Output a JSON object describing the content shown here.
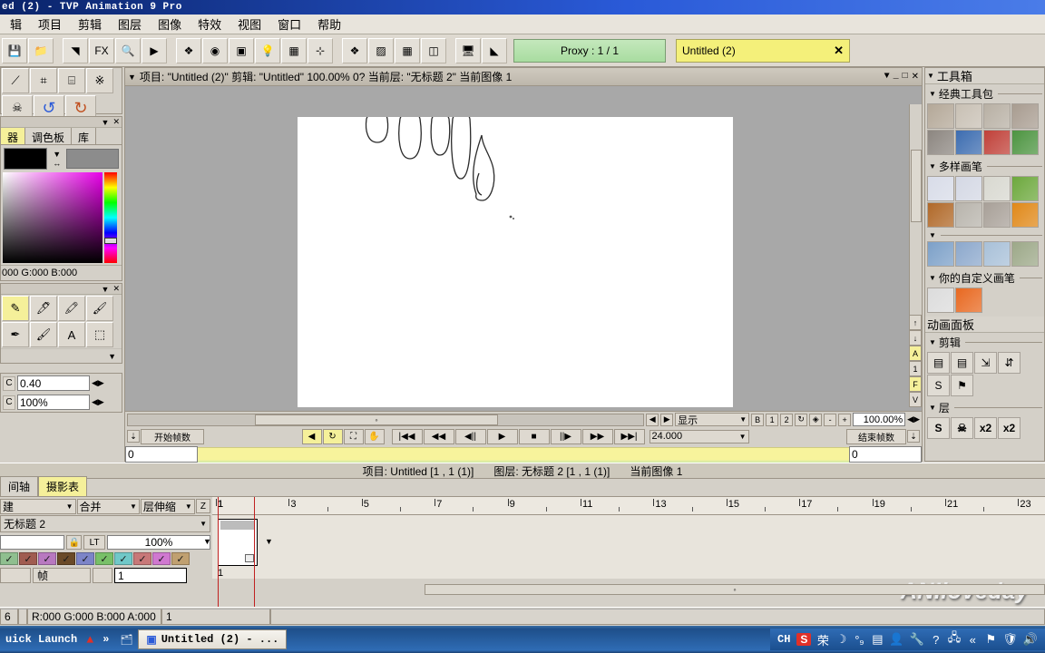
{
  "window": {
    "title": "ed (2) - TVP Animation 9 Pro"
  },
  "menubar": {
    "items": [
      {
        "label": "辑"
      },
      {
        "label": "项目"
      },
      {
        "label": "剪辑"
      },
      {
        "label": "图层"
      },
      {
        "label": "图像"
      },
      {
        "label": "特效"
      },
      {
        "label": "视图"
      },
      {
        "label": "窗口"
      },
      {
        "label": "帮助"
      }
    ]
  },
  "toolbar": {
    "buttons": [
      {
        "name": "save-button",
        "glyph": "💾"
      },
      {
        "name": "open-folder-button",
        "glyph": "📁"
      },
      {
        "name": "layers-stack-button",
        "glyph": "◥"
      },
      {
        "name": "fx-button",
        "glyph": "FX"
      },
      {
        "name": "zoom-button",
        "glyph": "🔍"
      },
      {
        "name": "play-button",
        "glyph": "▶"
      },
      {
        "name": "stack-button",
        "glyph": "❖"
      },
      {
        "name": "color-wheel-button",
        "glyph": "◉"
      },
      {
        "name": "gradient-button",
        "glyph": "▣"
      },
      {
        "name": "light-button",
        "glyph": "💡"
      },
      {
        "name": "grid-button",
        "glyph": "▦"
      },
      {
        "name": "axis-button",
        "glyph": "⊹"
      },
      {
        "name": "layers-red-button",
        "glyph": "❖"
      },
      {
        "name": "texture-button",
        "glyph": "▨"
      },
      {
        "name": "table-grid-button",
        "glyph": "▦"
      },
      {
        "name": "panel-split-button",
        "glyph": "◫"
      },
      {
        "name": "monitor-button",
        "glyph": "🖥"
      },
      {
        "name": "ramp-button",
        "glyph": "◣"
      }
    ],
    "proxy_label": "Proxy : 1 / 1",
    "document_tab": "Untitled (2)",
    "document_tab_close": "✕"
  },
  "left_panel": {
    "color_tabs": [
      {
        "label": "器",
        "active": true
      },
      {
        "label": "调色板",
        "active": false
      },
      {
        "label": "库",
        "active": false
      }
    ],
    "rgb_readout": "000 G:000 B:000",
    "tools": [
      {
        "name": "pencil-tool",
        "glyph": "✎",
        "selected": true
      },
      {
        "name": "pen-tool",
        "glyph": "🖊",
        "selected": false
      },
      {
        "name": "marker-tool",
        "glyph": "🖍",
        "selected": false
      },
      {
        "name": "brush-tool",
        "glyph": "🖌",
        "selected": false
      },
      {
        "name": "airbrush-tool",
        "glyph": "✒",
        "selected": false
      },
      {
        "name": "felt-tool",
        "glyph": "🖌",
        "selected": false
      },
      {
        "name": "text-tool",
        "glyph": "A",
        "selected": false
      },
      {
        "name": "select-tool",
        "glyph": "⬚",
        "selected": false
      }
    ],
    "fields": [
      {
        "prefix": "C",
        "value": "0.40"
      },
      {
        "prefix": "C",
        "value": "100%"
      }
    ],
    "top_tools": [
      {
        "name": "skull-button",
        "glyph": "☠"
      },
      {
        "name": "undo-button",
        "glyph": "↺"
      },
      {
        "name": "redo-button",
        "glyph": "↻"
      }
    ]
  },
  "document_window": {
    "info_line": "项目: \"Untitled (2)\"  剪辑: \"Untitled\"  100.00%   0?  当前层: \"无标题 2\"  当前图像 1",
    "minimize": "_",
    "maximize": "□",
    "close": "✕",
    "side_buttons": [
      {
        "label": "↑",
        "highlight": false
      },
      {
        "label": "↓",
        "highlight": false
      },
      {
        "label": "A",
        "highlight": true
      },
      {
        "label": "1",
        "highlight": false
      },
      {
        "label": "F",
        "highlight": true
      },
      {
        "label": "V",
        "highlight": false
      }
    ],
    "display_dropdown": "显示",
    "view_buttons": [
      "B",
      "1",
      "2"
    ],
    "refresh_button": "↻",
    "fit_button": "◈",
    "zoom_out": "-",
    "zoom_in": "+",
    "zoom_value": "100.00%",
    "playback": {
      "loop_buttons": [
        {
          "name": "direction-button",
          "glyph": "◀",
          "highlight": true
        },
        {
          "name": "loop-button",
          "glyph": "↻",
          "highlight": true
        },
        {
          "name": "range-button",
          "glyph": "⛶",
          "highlight": false
        },
        {
          "name": "hand-button",
          "glyph": "✋",
          "highlight": false
        }
      ],
      "transport_buttons": [
        {
          "name": "go-to-start-button",
          "glyph": "|◀◀"
        },
        {
          "name": "rewind-button",
          "glyph": "◀◀"
        },
        {
          "name": "step-back-button",
          "glyph": "◀||"
        },
        {
          "name": "play-button",
          "glyph": "▶"
        },
        {
          "name": "stop-button",
          "glyph": "■"
        },
        {
          "name": "step-forward-button",
          "glyph": "||▶"
        },
        {
          "name": "fast-forward-button",
          "glyph": "▶▶"
        },
        {
          "name": "go-to-end-button",
          "glyph": "▶▶|"
        }
      ],
      "fps_value": "24.000"
    },
    "start_frame_label": "开始帧数",
    "start_frame_value": "0",
    "end_frame_label": "结束帧数",
    "end_frame_value": "0"
  },
  "toolbox": {
    "title": "工具箱",
    "sections": [
      {
        "title": "经典工具包",
        "items": [
          {
            "name": "classic-pencil",
            "bg": "#b4a898"
          },
          {
            "name": "classic-pen",
            "bg": "#c8c0b4"
          },
          {
            "name": "classic-marker",
            "bg": "#b8b0a4"
          },
          {
            "name": "classic-chalk",
            "bg": "#a89c90"
          },
          {
            "name": "classic-charcoal",
            "bg": "#8c8680"
          },
          {
            "name": "classic-blue-ball",
            "bg": "#3c6cb0"
          },
          {
            "name": "classic-red-brush",
            "bg": "#c04038"
          },
          {
            "name": "classic-green-leaf",
            "bg": "#4c9440"
          }
        ]
      },
      {
        "title": "多样画笔",
        "items": [
          {
            "name": "brush-scribble",
            "bg": "#d8dce8"
          },
          {
            "name": "brush-text",
            "bg": "#d4d8e4"
          },
          {
            "name": "brush-sparkle",
            "bg": "#d8d8d0"
          },
          {
            "name": "brush-grass",
            "bg": "#6ca83c"
          },
          {
            "name": "brush-planet",
            "bg": "#b06828"
          },
          {
            "name": "brush-stroke",
            "bg": "#b8b4ac"
          },
          {
            "name": "brush-fur",
            "bg": "#a8a098"
          },
          {
            "name": "brush-flame",
            "bg": "#e08818"
          }
        ]
      },
      {
        "title": "",
        "items": [
          {
            "name": "brush-fade-left",
            "bg": "#7ca0c8"
          },
          {
            "name": "brush-fade-right",
            "bg": "#8ca8cc"
          },
          {
            "name": "brush-arrow",
            "bg": "#a8c0d8"
          },
          {
            "name": "brush-blur",
            "bg": "#9ca888"
          }
        ]
      },
      {
        "title": "你的自定义画笔",
        "items": [
          {
            "name": "custom-arrow-white",
            "bg": "#dcdcdc"
          },
          {
            "name": "custom-arrow-orange",
            "bg": "#e86820"
          }
        ]
      }
    ],
    "animation_panel_title": "动画面板",
    "clip_section_title": "剪辑",
    "clip_buttons": [
      {
        "name": "clip-insert-left",
        "glyph": "▤"
      },
      {
        "name": "clip-insert-right",
        "glyph": "▤"
      },
      {
        "name": "clip-move",
        "glyph": "⇲"
      },
      {
        "name": "clip-duplicate",
        "glyph": "⇵"
      },
      {
        "name": "clip-scene",
        "glyph": "S"
      },
      {
        "name": "clip-flag",
        "glyph": "⚑"
      }
    ],
    "layer_section_title": "层",
    "layer_buttons": [
      {
        "name": "layer-s-button",
        "label": "S"
      },
      {
        "name": "layer-delete-button",
        "label": "☠"
      },
      {
        "name": "layer-x2a-button",
        "label": "x2"
      },
      {
        "name": "layer-x2b-button",
        "label": "x2"
      }
    ]
  },
  "status": {
    "project": "项目: Untitled [1 , 1 (1)]",
    "layer": "图层: 无标题 2 [1 , 1 (1)]",
    "current_image": "当前图像 1"
  },
  "timeline": {
    "tabs": [
      {
        "label": "间轴",
        "active": false
      },
      {
        "label": "摄影表",
        "active": true
      }
    ],
    "dropdowns": [
      {
        "name": "create-dropdown",
        "label": "建"
      },
      {
        "name": "merge-dropdown",
        "label": "合并"
      },
      {
        "name": "layer-stretch-dropdown",
        "label": "层伸缩"
      }
    ],
    "z_button": "Z",
    "layer_name": "无标题 2",
    "lock_icon": "🔒",
    "lt_button": "LT",
    "opacity": "100%",
    "checkbox_colors": [
      "#8fbf8f",
      "#a05c50",
      "#b878c0",
      "#6a4a28",
      "#7c84c8",
      "#78c068",
      "#70c8c8",
      "#c87878",
      "#d078d0",
      "#c0a070"
    ],
    "checkbox_mark": "✓",
    "frame_label": "帧",
    "frame_value": "1",
    "ruler_ticks": [
      "1",
      "3",
      "5",
      "7",
      "9",
      "11",
      "13",
      "15",
      "17",
      "19",
      "21",
      "23"
    ],
    "cell_number_top": "1",
    "cell_number_bottom": "1",
    "watermark": "ANIloveday"
  },
  "bottom_status": {
    "left_value": "6",
    "color_readout": "R:000 G:000 B:000 A:000",
    "frame_number": "1"
  },
  "taskbar": {
    "quick_launch_label": "uick Launch",
    "chevron": "»",
    "window_button": "Untitled (2) - ...",
    "tray": {
      "input_method": "CH",
      "icons": [
        {
          "name": "sogou-icon",
          "glyph": "S"
        },
        {
          "name": "pinyin-icon",
          "glyph": "荣"
        },
        {
          "name": "moon-icon",
          "glyph": "☽"
        },
        {
          "name": "bubbles-icon",
          "glyph": "°₉"
        },
        {
          "name": "list-icon",
          "glyph": "▤"
        },
        {
          "name": "person-icon",
          "glyph": "👤"
        },
        {
          "name": "wrench-icon",
          "glyph": "🔧"
        },
        {
          "name": "help-icon",
          "glyph": "?"
        },
        {
          "name": "network-icon",
          "glyph": "🖧"
        },
        {
          "name": "expand-icon",
          "glyph": "«"
        },
        {
          "name": "flag-icon",
          "glyph": "⚑"
        },
        {
          "name": "shield-icon",
          "glyph": "🛡"
        },
        {
          "name": "volume-icon",
          "glyph": "🔊"
        }
      ]
    }
  }
}
